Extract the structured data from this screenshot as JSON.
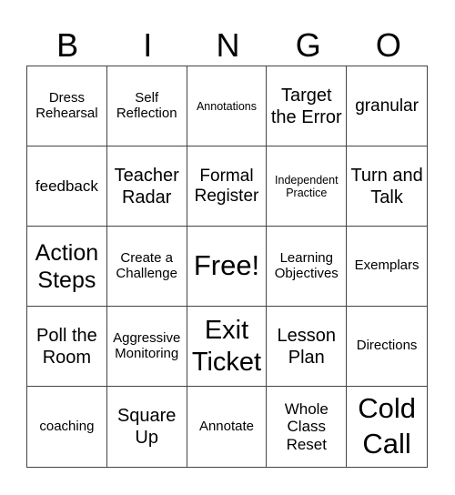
{
  "header": {
    "letters": [
      "B",
      "I",
      "N",
      "G",
      "O"
    ]
  },
  "cells": [
    [
      "Dress Rehearsal",
      "Self Reflection",
      "Annotations",
      "Target the Error",
      "granular"
    ],
    [
      "feedback",
      "Teacher Radar",
      "Formal Register",
      "Independent Practice",
      "Turn and Talk"
    ],
    [
      "Action Steps",
      "Create a Challenge",
      "Free!",
      "Learning Objectives",
      "Exemplars"
    ],
    [
      "Poll the Room",
      "Aggressive Monitoring",
      "Exit Ticket",
      "Lesson Plan",
      "Directions"
    ],
    [
      "coaching",
      "Square Up",
      "Annotate",
      "Whole Class Reset",
      "Cold Call"
    ]
  ]
}
